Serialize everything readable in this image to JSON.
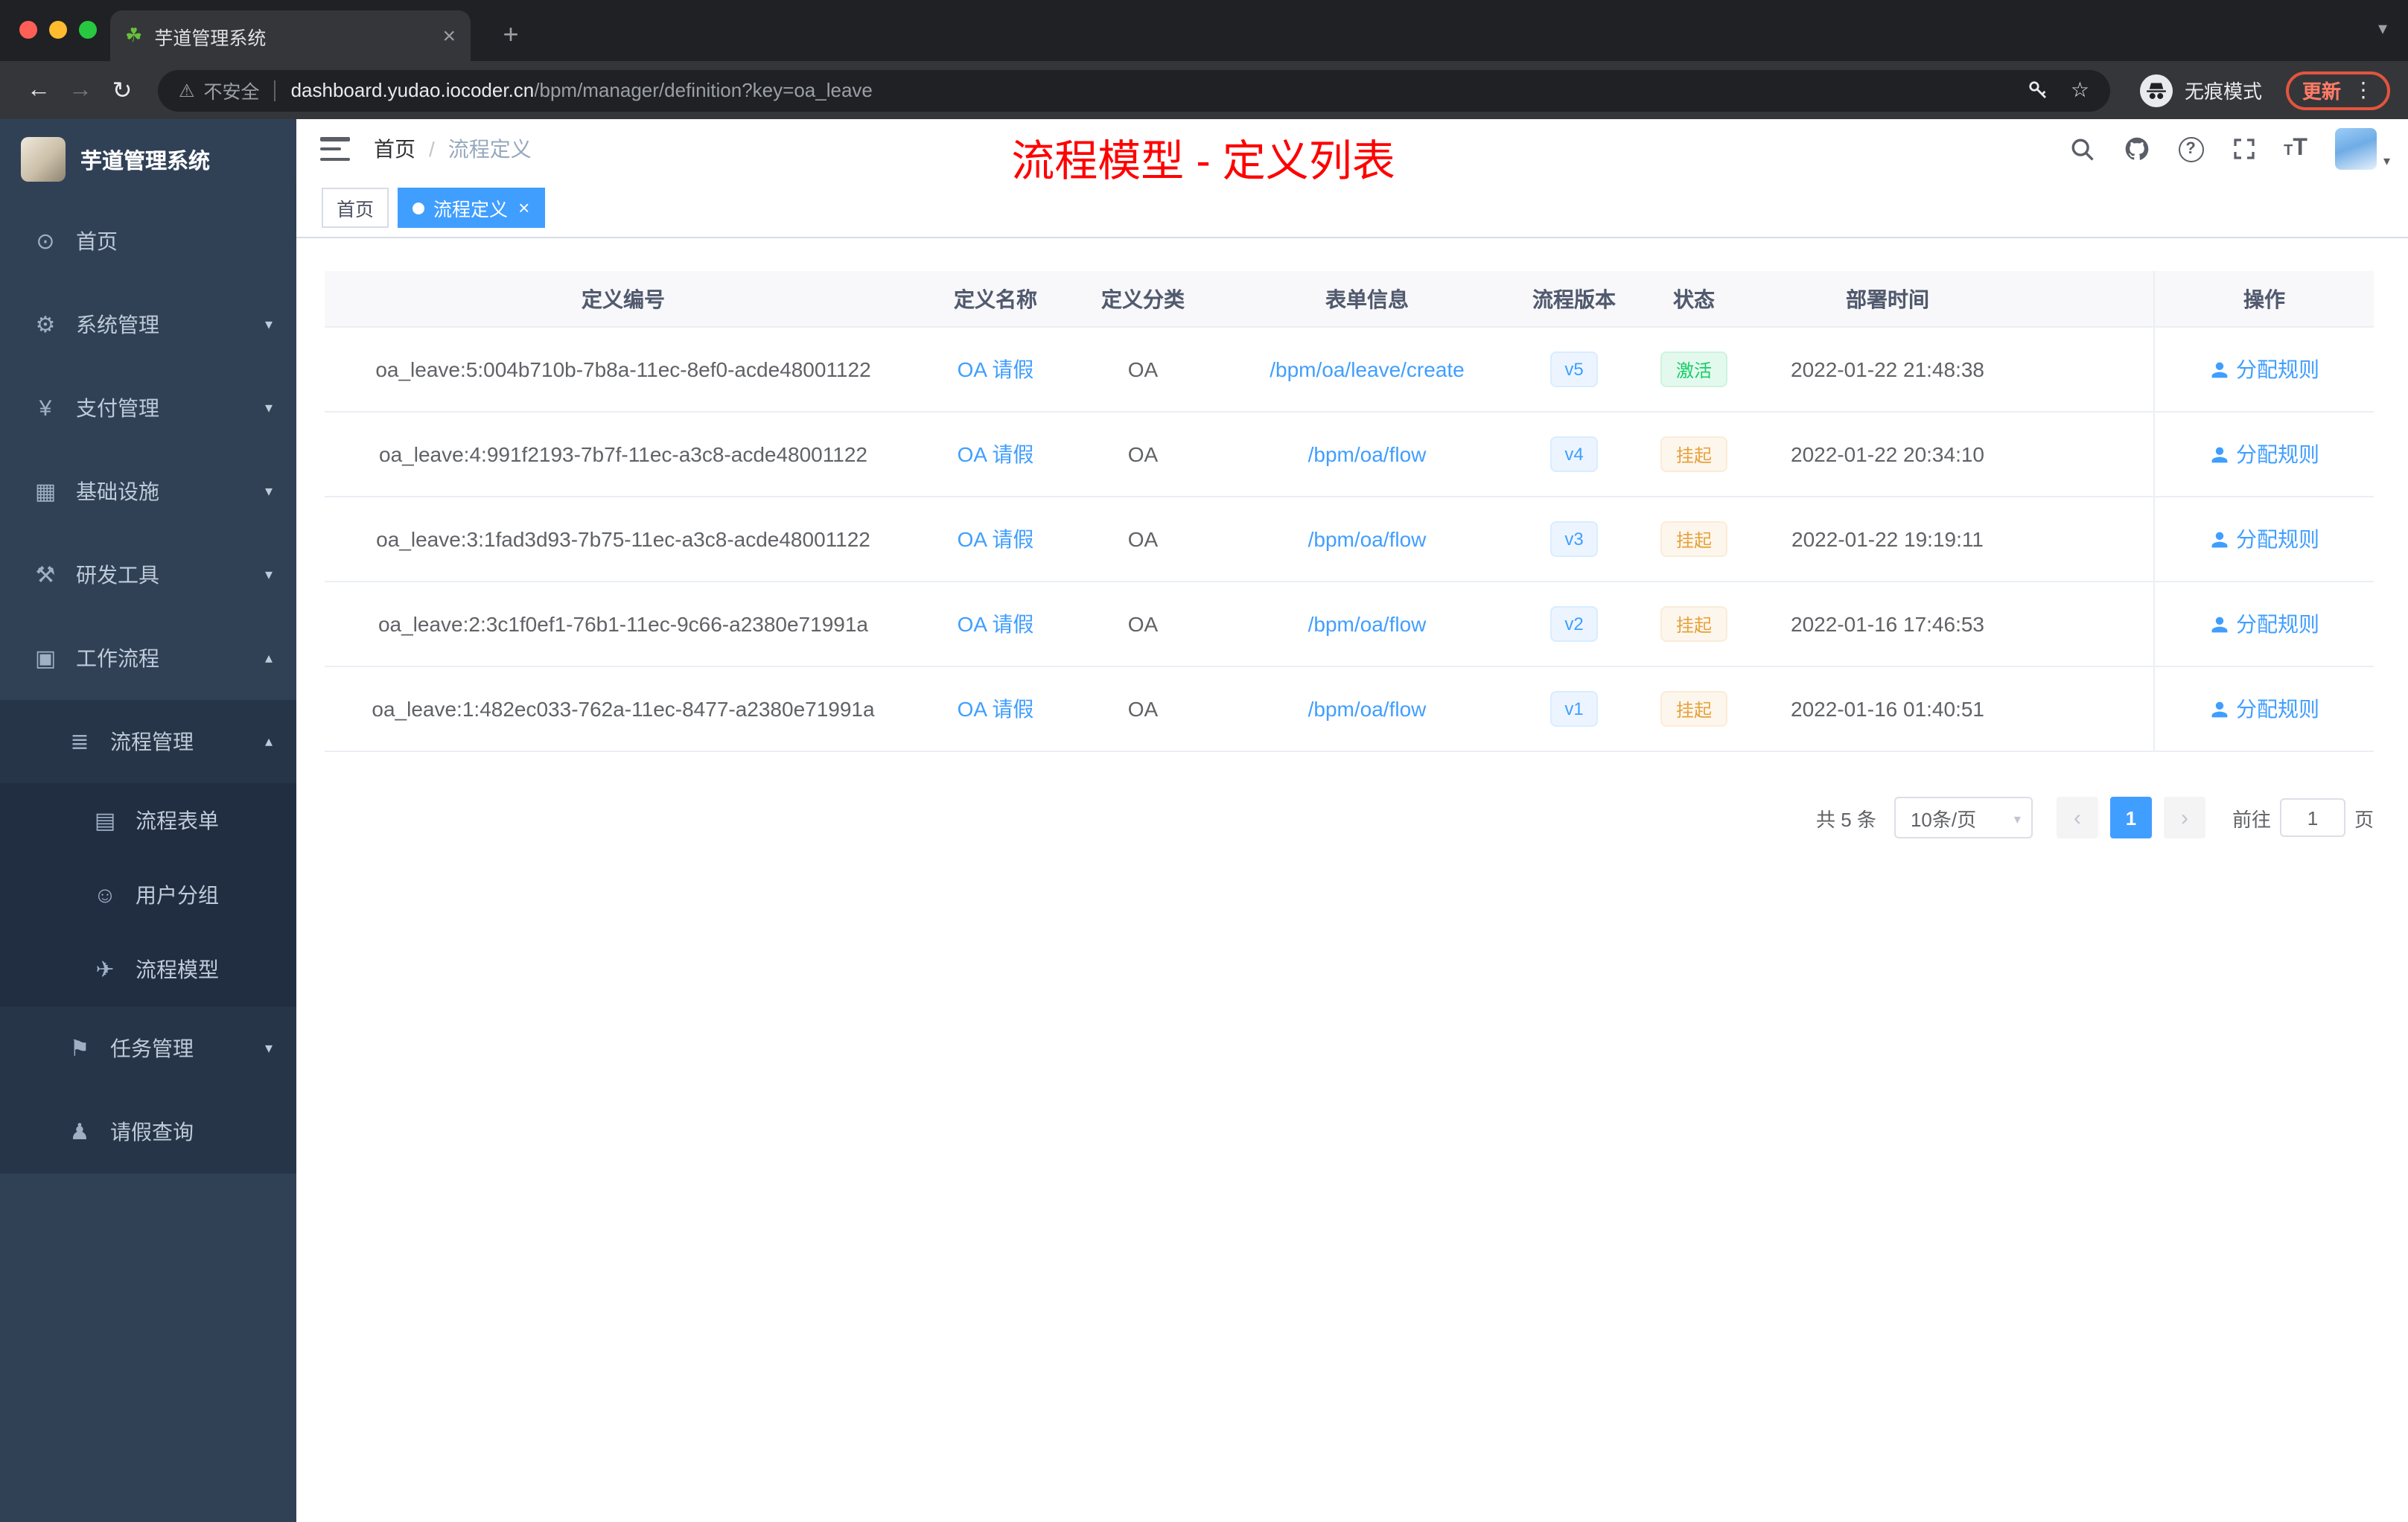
{
  "browser": {
    "tab_title": "芋道管理系统",
    "security_label": "不安全",
    "url_domain": "dashboard.yudao.iocoder.cn",
    "url_path": "/bpm/manager/definition?key=oa_leave",
    "incognito_label": "无痕模式",
    "update_label": "更新"
  },
  "glyphs": {
    "favicon": "☘",
    "close": "×",
    "plus": "+",
    "caret_down": "▾",
    "back": "←",
    "forward": "→",
    "reload": "↻",
    "warning": "⚠",
    "star": "☆",
    "kebab": "⋮",
    "help": "?",
    "font_size_big": "T",
    "font_size_small": "T"
  },
  "sidebar": {
    "logo_title": "芋道管理系统",
    "items": [
      {
        "label": "首页",
        "icon": "home-icon",
        "glyph": "⊙",
        "level": 0,
        "arrow": ""
      },
      {
        "label": "系统管理",
        "icon": "system-manage-icon",
        "glyph": "⚙",
        "level": 0,
        "arrow": "▾"
      },
      {
        "label": "支付管理",
        "icon": "payment-manage-icon",
        "glyph": "¥",
        "level": 0,
        "arrow": "▾"
      },
      {
        "label": "基础设施",
        "icon": "infrastructure-icon",
        "glyph": "▦",
        "level": 0,
        "arrow": "▾"
      },
      {
        "label": "研发工具",
        "icon": "dev-tools-icon",
        "glyph": "⚒",
        "level": 0,
        "arrow": "▾"
      },
      {
        "label": "工作流程",
        "icon": "workflow-icon",
        "glyph": "▣",
        "level": 0,
        "arrow": "▴"
      },
      {
        "label": "流程管理",
        "icon": "process-manage-icon",
        "glyph": "≣",
        "level": 1,
        "arrow": "▴"
      },
      {
        "label": "流程表单",
        "icon": "process-form-icon",
        "glyph": "▤",
        "level": 2,
        "arrow": ""
      },
      {
        "label": "用户分组",
        "icon": "user-group-icon",
        "glyph": "☺",
        "level": 2,
        "arrow": ""
      },
      {
        "label": "流程模型",
        "icon": "process-model-icon",
        "glyph": "✈",
        "level": 2,
        "arrow": ""
      },
      {
        "label": "任务管理",
        "icon": "task-manage-icon",
        "glyph": "⚑",
        "level": 1,
        "arrow": "▾"
      },
      {
        "label": "请假查询",
        "icon": "leave-query-icon",
        "glyph": "♟",
        "level": 1,
        "arrow": ""
      }
    ]
  },
  "header": {
    "breadcrumb_home": "首页",
    "breadcrumb_separator": "/",
    "breadcrumb_current": "流程定义",
    "page_title": "流程模型 - 定义列表"
  },
  "tags": {
    "home": "首页",
    "current": "流程定义"
  },
  "table": {
    "columns": [
      "定义编号",
      "定义名称",
      "定义分类",
      "表单信息",
      "流程版本",
      "状态",
      "部署时间",
      "操作"
    ],
    "action_label": "分配规则",
    "rows": [
      {
        "id": "oa_leave:5:004b710b-7b8a-11ec-8ef0-acde48001122",
        "name": "OA 请假",
        "category": "OA",
        "form": "/bpm/oa/leave/create",
        "version": "v5",
        "status": "激活",
        "status_type": "success",
        "time": "2022-01-22 21:48:38"
      },
      {
        "id": "oa_leave:4:991f2193-7b7f-11ec-a3c8-acde48001122",
        "name": "OA 请假",
        "category": "OA",
        "form": "/bpm/oa/flow",
        "version": "v4",
        "status": "挂起",
        "status_type": "warning",
        "time": "2022-01-22 20:34:10"
      },
      {
        "id": "oa_leave:3:1fad3d93-7b75-11ec-a3c8-acde48001122",
        "name": "OA 请假",
        "category": "OA",
        "form": "/bpm/oa/flow",
        "version": "v3",
        "status": "挂起",
        "status_type": "warning",
        "time": "2022-01-22 19:19:11"
      },
      {
        "id": "oa_leave:2:3c1f0ef1-76b1-11ec-9c66-a2380e71991a",
        "name": "OA 请假",
        "category": "OA",
        "form": "/bpm/oa/flow",
        "version": "v2",
        "status": "挂起",
        "status_type": "warning",
        "time": "2022-01-16 17:46:53"
      },
      {
        "id": "oa_leave:1:482ec033-762a-11ec-8477-a2380e71991a",
        "name": "OA 请假",
        "category": "OA",
        "form": "/bpm/oa/flow",
        "version": "v1",
        "status": "挂起",
        "status_type": "warning",
        "time": "2022-01-16 01:40:51"
      }
    ]
  },
  "pagination": {
    "total": "共 5 条",
    "page_size": "10条/页",
    "prev": "‹",
    "current_page": "1",
    "next": "›",
    "goto_label": "前往",
    "goto_value": "1",
    "page_suffix": "页"
  },
  "colors": {
    "accent": "#409EFF",
    "title_red": "#FF0000",
    "success": "#13CE66",
    "warning": "#E6A23C"
  }
}
